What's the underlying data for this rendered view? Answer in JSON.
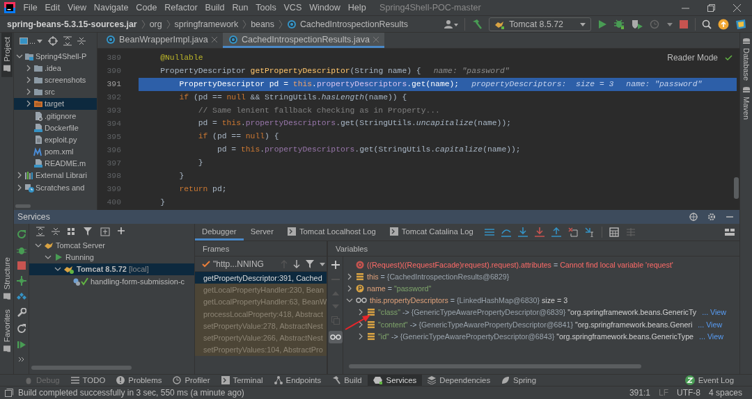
{
  "window": {
    "title": "Spring4Shell-POC-master"
  },
  "menu": [
    "File",
    "Edit",
    "View",
    "Navigate",
    "Code",
    "Refactor",
    "Build",
    "Run",
    "Tools",
    "VCS",
    "Window",
    "Help"
  ],
  "breadcrumbs": [
    {
      "label": "spring-beans-5.3.15-sources.jar",
      "kind": "jar"
    },
    {
      "label": "org",
      "kind": "package"
    },
    {
      "label": "springframework",
      "kind": "package"
    },
    {
      "label": "beans",
      "kind": "package"
    },
    {
      "label": "CachedIntrospectionResults",
      "kind": "class"
    }
  ],
  "run_config": {
    "label": "Tomcat 8.5.72"
  },
  "left_stripe": {
    "top": [
      {
        "label": "Project",
        "selected": true
      }
    ],
    "bottom": [
      {
        "label": "Structure",
        "selected": false
      },
      {
        "label": "Favorites",
        "selected": false
      }
    ]
  },
  "right_stripe": [
    {
      "label": "Database"
    },
    {
      "label": "Maven"
    }
  ],
  "project": {
    "view_selector": "...",
    "tree": [
      {
        "label": "Spring4Shell-P",
        "kind": "module",
        "expanded": true,
        "selected": false,
        "children": [
          {
            "label": ".idea",
            "kind": "folder",
            "expanded": false,
            "selected": false
          },
          {
            "label": "screenshots",
            "kind": "folder",
            "expanded": false,
            "selected": false
          },
          {
            "label": "src",
            "kind": "folder",
            "expanded": false,
            "selected": false
          },
          {
            "label": "target",
            "kind": "excluded",
            "expanded": false,
            "selected": true
          },
          {
            "label": ".gitignore",
            "kind": "ignore",
            "selected": false
          },
          {
            "label": "Dockerfile",
            "kind": "docker",
            "selected": false
          },
          {
            "label": "exploit.py",
            "kind": "text",
            "selected": false
          },
          {
            "label": "pom.xml",
            "kind": "maven",
            "selected": false
          },
          {
            "label": "README.m",
            "kind": "markdown",
            "selected": false
          }
        ]
      },
      {
        "label": "External Librari",
        "kind": "libraries",
        "expanded": false,
        "selected": false
      },
      {
        "label": "Scratches and",
        "kind": "scratches",
        "expanded": false,
        "selected": false
      }
    ]
  },
  "editor": {
    "tabs": [
      {
        "label": "BeanWrapperImpl.java",
        "selected": false
      },
      {
        "label": "CachedIntrospectionResults.java",
        "selected": true
      }
    ],
    "reader_mode": "Reader Mode",
    "lines": [
      {
        "number": "389",
        "selected": false,
        "tokens": [
          {
            "kind": "annotation",
            "text": "    @Nullable"
          }
        ]
      },
      {
        "number": "390",
        "selected": false,
        "tokens": [
          {
            "kind": "plain",
            "text": "    PropertyDescriptor "
          },
          {
            "kind": "method",
            "text": "getPropertyDescriptor"
          },
          {
            "kind": "plain",
            "text": "(String name) {"
          },
          {
            "kind": "hint",
            "text": "name: \"password\""
          }
        ]
      },
      {
        "number": "391",
        "selected": true,
        "tokens": [
          {
            "kind": "plain",
            "text": "        PropertyDescriptor pd = "
          },
          {
            "kind": "keyword",
            "text": "this"
          },
          {
            "kind": "plain",
            "text": "."
          },
          {
            "kind": "field",
            "text": "propertyDescriptors"
          },
          {
            "kind": "plain",
            "text": ".get(name);"
          },
          {
            "kind": "hint",
            "text": "propertyDescriptors:  size = 3"
          },
          {
            "kind": "hint",
            "text": "name: \"password\""
          }
        ]
      },
      {
        "number": "392",
        "selected": false,
        "tokens": [
          {
            "kind": "keyword",
            "text": "        if"
          },
          {
            "kind": "plain",
            "text": " (pd == "
          },
          {
            "kind": "keyword",
            "text": "null"
          },
          {
            "kind": "plain",
            "text": " && StringUtils."
          },
          {
            "kind": "static",
            "text": "hasLength"
          },
          {
            "kind": "plain",
            "text": "(name)) {"
          }
        ]
      },
      {
        "number": "393",
        "selected": false,
        "tokens": [
          {
            "kind": "comment",
            "text": "            // Same lenient fallback checking as in Property..."
          }
        ]
      },
      {
        "number": "394",
        "selected": false,
        "tokens": [
          {
            "kind": "plain",
            "text": "            pd = "
          },
          {
            "kind": "keyword",
            "text": "this"
          },
          {
            "kind": "plain",
            "text": "."
          },
          {
            "kind": "field",
            "text": "propertyDescriptors"
          },
          {
            "kind": "plain",
            "text": ".get(StringUtils."
          },
          {
            "kind": "static",
            "text": "uncapitalize"
          },
          {
            "kind": "plain",
            "text": "(name));"
          }
        ]
      },
      {
        "number": "395",
        "selected": false,
        "tokens": [
          {
            "kind": "keyword",
            "text": "            if"
          },
          {
            "kind": "plain",
            "text": " (pd == "
          },
          {
            "kind": "keyword",
            "text": "null"
          },
          {
            "kind": "plain",
            "text": ") {"
          }
        ]
      },
      {
        "number": "396",
        "selected": false,
        "tokens": [
          {
            "kind": "plain",
            "text": "                pd = "
          },
          {
            "kind": "keyword",
            "text": "this"
          },
          {
            "kind": "plain",
            "text": "."
          },
          {
            "kind": "field",
            "text": "propertyDescriptors"
          },
          {
            "kind": "plain",
            "text": ".get(StringUtils."
          },
          {
            "kind": "static",
            "text": "capitalize"
          },
          {
            "kind": "plain",
            "text": "(name));"
          }
        ]
      },
      {
        "number": "397",
        "selected": false,
        "tokens": [
          {
            "kind": "plain",
            "text": "            }"
          }
        ]
      },
      {
        "number": "398",
        "selected": false,
        "tokens": [
          {
            "kind": "plain",
            "text": "        }"
          }
        ]
      },
      {
        "number": "399",
        "selected": false,
        "tokens": [
          {
            "kind": "keyword",
            "text": "        return"
          },
          {
            "kind": "plain",
            "text": " pd;"
          }
        ]
      },
      {
        "number": "400",
        "selected": false,
        "tokens": [
          {
            "kind": "plain",
            "text": "    }"
          }
        ]
      }
    ]
  },
  "services": {
    "title": "Services",
    "tree": [
      {
        "label": "Tomcat Server",
        "kind": "server",
        "expanded": true,
        "selected": false,
        "children": [
          {
            "label": "Running",
            "kind": "running",
            "expanded": true,
            "selected": false,
            "children": [
              {
                "label": "Tomcat 8.5.72",
                "suffix": "[local]",
                "kind": "tomcat",
                "expanded": true,
                "selected": true,
                "children": [
                  {
                    "label": "handling-form-submission-c",
                    "kind": "artifact",
                    "selected": false
                  }
                ]
              }
            ]
          }
        ]
      }
    ],
    "tabs": [
      {
        "label": "Debugger",
        "kind": "plain",
        "selected": true
      },
      {
        "label": "Server",
        "kind": "plain",
        "selected": false
      },
      {
        "label": "Tomcat Localhost Log",
        "kind": "log",
        "selected": false
      },
      {
        "label": "Tomcat Catalina Log",
        "kind": "log",
        "selected": false
      }
    ],
    "frames": {
      "title": "Frames",
      "thread": "\"http...NNING",
      "items": [
        {
          "label": "getPropertyDescriptor:391, Cached",
          "library": false,
          "selected": true
        },
        {
          "label": "getLocalPropertyHandler:230, Bean",
          "library": true,
          "selected": false
        },
        {
          "label": "getLocalPropertyHandler:63, BeanW",
          "library": true,
          "selected": false
        },
        {
          "label": "processLocalProperty:418, Abstract",
          "library": true,
          "selected": false
        },
        {
          "label": "setPropertyValue:278, AbstractNest",
          "library": true,
          "selected": false
        },
        {
          "label": "setPropertyValue:266, AbstractNest",
          "library": true,
          "selected": false
        },
        {
          "label": "setPropertyValues:104, AbstractPro",
          "library": true,
          "selected": false
        }
      ]
    },
    "variables": {
      "title": "Variables",
      "items": [
        {
          "kind": "error",
          "name": "((Request)((RequestFacade)request).request).attributes",
          "separator": "=",
          "value": "Cannot find local variable 'request'"
        },
        {
          "kind": "object",
          "name": "this",
          "separator": "=",
          "value": "{CachedIntrospectionResults@6829}",
          "expanded": false
        },
        {
          "kind": "primitive",
          "name": "name",
          "separator": "=",
          "value": "\"password\"",
          "expanded": false
        },
        {
          "kind": "watch",
          "name": "this.propertyDescriptors",
          "separator": "=",
          "value": "{LinkedHashMap@6830}",
          "suffix": "size = 3",
          "expanded": true,
          "children": [
            {
              "kind": "entry",
              "name": "\"class\"",
              "separator": "->",
              "value": "{GenericTypeAwarePropertyDescriptor@6839}",
              "suffix": "\"org.springframework.beans.GenericTy",
              "link": "... View",
              "expanded": false
            },
            {
              "kind": "entry",
              "name": "\"content\"",
              "separator": "->",
              "value": "{GenericTypeAwarePropertyDescriptor@6841}",
              "suffix": "\"org.springframework.beans.Generi",
              "link": "... View",
              "expanded": false
            },
            {
              "kind": "entry",
              "name": "\"id\"",
              "separator": "->",
              "value": "{GenericTypeAwarePropertyDescriptor@6843}",
              "suffix": "\"org.springframework.beans.GenericType",
              "link": "... View",
              "expanded": false
            }
          ]
        }
      ]
    }
  },
  "tool_tabs": {
    "left": [
      {
        "label": "Debug",
        "kind": "debug",
        "selected": false,
        "disabled": true
      },
      {
        "label": "TODO",
        "kind": "todo",
        "selected": false,
        "disabled": false
      },
      {
        "label": "Problems",
        "kind": "problems",
        "selected": false,
        "disabled": false
      },
      {
        "label": "Profiler",
        "kind": "profiler",
        "selected": false,
        "disabled": false
      },
      {
        "label": "Terminal",
        "kind": "terminal",
        "selected": false,
        "disabled": false
      },
      {
        "label": "Endpoints",
        "kind": "endpoints",
        "selected": false,
        "disabled": false
      },
      {
        "label": "Build",
        "kind": "build",
        "selected": false,
        "disabled": false
      },
      {
        "label": "Services",
        "kind": "services",
        "selected": true,
        "disabled": false
      },
      {
        "label": "Dependencies",
        "kind": "dependencies",
        "selected": false,
        "disabled": false
      },
      {
        "label": "Spring",
        "kind": "spring",
        "selected": false,
        "disabled": false
      }
    ],
    "right": [
      {
        "label": "Event Log",
        "kind": "eventlog",
        "selected": false,
        "disabled": false
      }
    ]
  },
  "status_bar": {
    "message": "Build completed successfully in 3 sec, 550 ms (a minute ago)",
    "position": "391:1",
    "line_separator": "LF",
    "encoding": "UTF-8",
    "indent": "4 spaces"
  }
}
